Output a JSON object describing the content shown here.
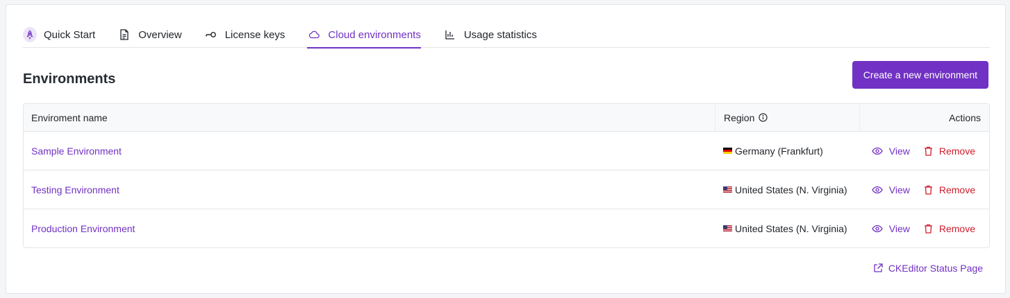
{
  "tabs": [
    {
      "label": "Quick Start",
      "icon": "rocket-icon",
      "active": false
    },
    {
      "label": "Overview",
      "icon": "document-icon",
      "active": false
    },
    {
      "label": "License keys",
      "icon": "key-icon",
      "active": false
    },
    {
      "label": "Cloud environments",
      "icon": "cloud-icon",
      "active": true
    },
    {
      "label": "Usage statistics",
      "icon": "bar-chart-icon",
      "active": false
    }
  ],
  "page": {
    "title": "Environments",
    "create_label": "Create a new environment"
  },
  "table": {
    "headers": {
      "name": "Enviroment name",
      "region": "Region",
      "actions": "Actions"
    },
    "rows": [
      {
        "name": "Sample Environment",
        "region": "Germany (Frankfurt)",
        "flag": "de"
      },
      {
        "name": "Testing Environment",
        "region": "United States (N. Virginia)",
        "flag": "us"
      },
      {
        "name": "Production Environment",
        "region": "United States (N. Virginia)",
        "flag": "us"
      }
    ],
    "view_label": "View",
    "remove_label": "Remove"
  },
  "footer": {
    "status_link": "CKEditor Status Page"
  },
  "colors": {
    "accent": "#7131c4",
    "danger": "#d11a2a",
    "border": "#e3e5e8"
  }
}
